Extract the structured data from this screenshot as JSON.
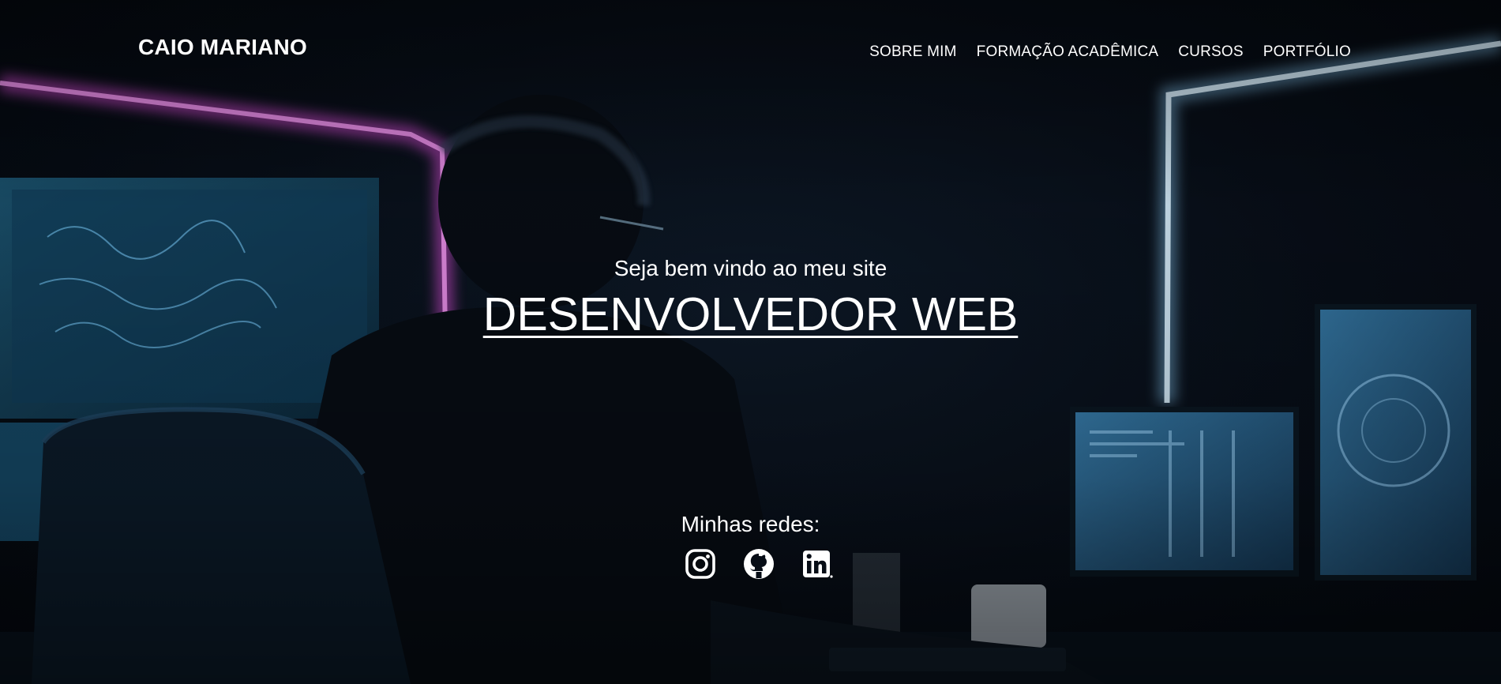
{
  "header": {
    "logo": "CAIO MARIANO",
    "nav": [
      {
        "label": "SOBRE MIM"
      },
      {
        "label": "FORMAÇÃO ACADÊMICA"
      },
      {
        "label": "CURSOS"
      },
      {
        "label": "PORTFÓLIO"
      }
    ]
  },
  "hero": {
    "welcome": "Seja bem vindo ao meu site",
    "headline": "DESENVOLVEDOR WEB",
    "networks_label": "Minhas redes:",
    "socials": [
      {
        "icon": "instagram-icon"
      },
      {
        "icon": "github-icon"
      },
      {
        "icon": "linkedin-icon"
      }
    ]
  },
  "colors": {
    "text": "#ffffff",
    "background": "#050a12",
    "neon_pink": "#e24fe0",
    "neon_blue": "#8fd3ff"
  }
}
